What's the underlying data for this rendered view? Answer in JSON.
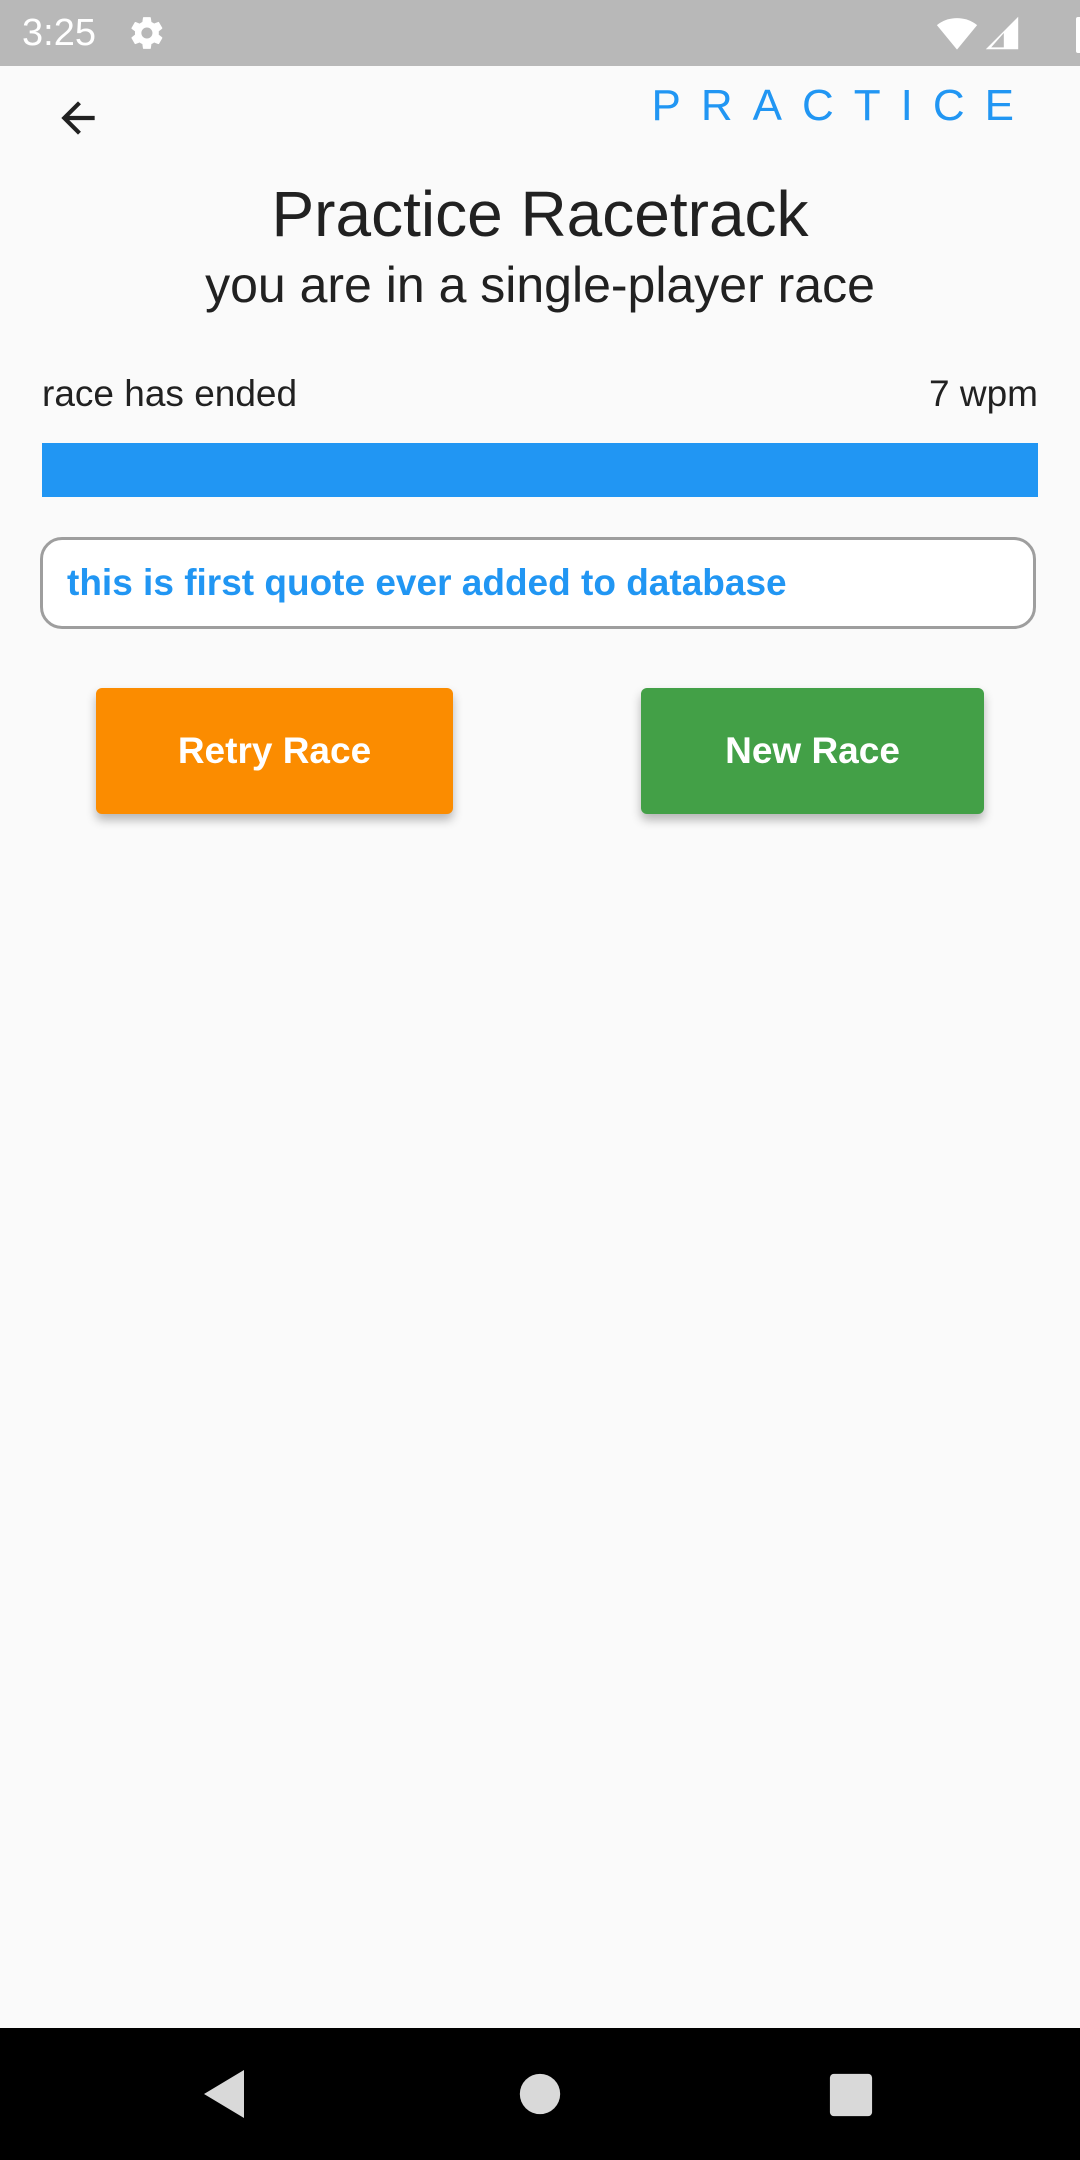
{
  "status_bar": {
    "time": "3:25",
    "icons": [
      "gear-icon",
      "wifi-icon",
      "cell-signal-icon",
      "battery-icon"
    ]
  },
  "app_bar": {
    "back_icon": "arrow-left-icon",
    "title": "PRACTICE"
  },
  "header": {
    "title": "Practice Racetrack",
    "subtitle": "you are in a single-player race"
  },
  "race": {
    "status": "race has ended",
    "wpm": "7 wpm",
    "progress_fraction": 1.0,
    "quote": "this is first quote ever added to database"
  },
  "actions": {
    "retry_label": "Retry Race",
    "new_label": "New Race"
  },
  "nav_bar": {
    "icons": [
      "nav-back-icon",
      "nav-home-icon",
      "nav-recents-icon"
    ]
  },
  "colors": {
    "accent": "#2196f3",
    "retry": "#fb8c00",
    "new": "#43a047",
    "background": "#fafafa"
  }
}
